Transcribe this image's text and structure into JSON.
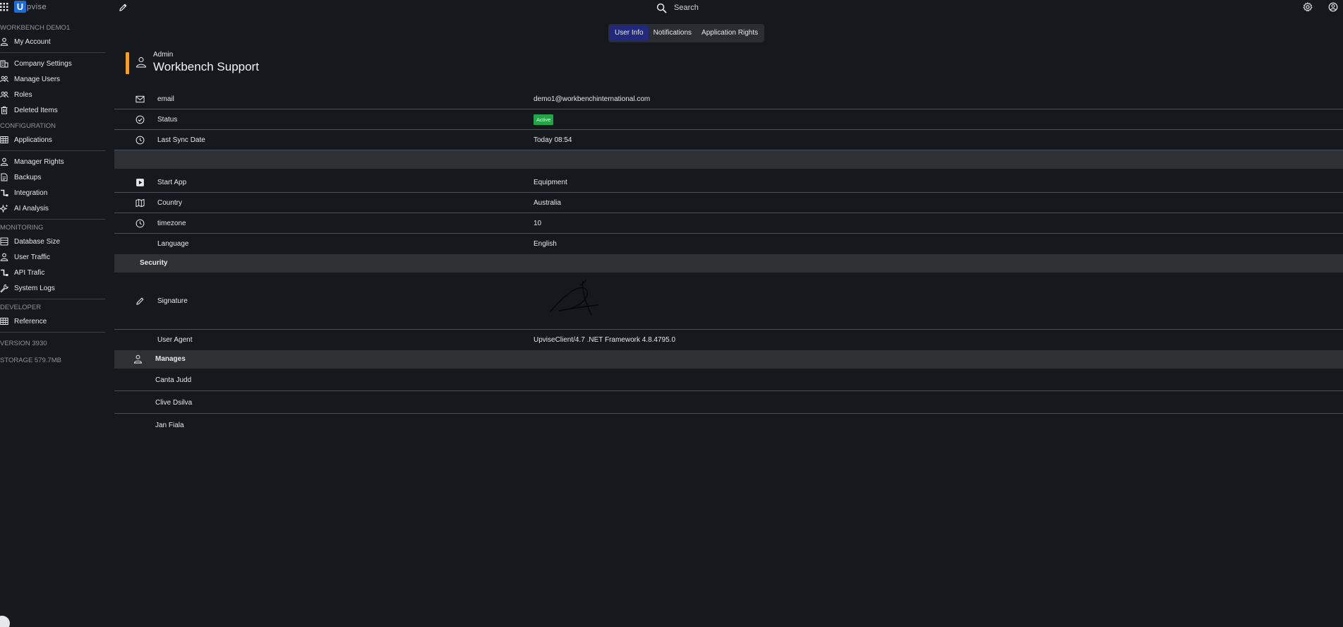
{
  "topbar": {
    "logo_letter": "U",
    "logo_word": "pvise",
    "search_placeholder": "Search"
  },
  "sidebar": {
    "workspace": "WORKBENCH DEMO1",
    "account_items": [
      {
        "label": "My Account",
        "icon": "user-icon"
      },
      {
        "label": "Company Settings",
        "icon": "building-icon"
      },
      {
        "label": "Manage Users",
        "icon": "users-icon"
      },
      {
        "label": "Roles",
        "icon": "users-icon"
      },
      {
        "label": "Deleted Items",
        "icon": "trash-icon"
      }
    ],
    "configuration_label": "CONFIGURATION",
    "configuration_items": [
      {
        "label": "Applications",
        "icon": "grid-icon"
      },
      {
        "label": "Manager Rights",
        "icon": "user-icon"
      },
      {
        "label": "Backups",
        "icon": "document-icon"
      },
      {
        "label": "Integration",
        "icon": "integration-icon"
      },
      {
        "label": "AI Analysis",
        "icon": "sparkle-icon"
      }
    ],
    "monitoring_label": "MONITORING",
    "monitoring_items": [
      {
        "label": "Database Size",
        "icon": "list-icon"
      },
      {
        "label": "User Traffic",
        "icon": "user-icon"
      },
      {
        "label": "API Trafic",
        "icon": "integration-icon"
      },
      {
        "label": "System Logs",
        "icon": "wrench-icon"
      }
    ],
    "developer_label": "DEVELOPER",
    "developer_items": [
      {
        "label": "Reference",
        "icon": "grid-icon"
      }
    ],
    "version": "VERSION 3930",
    "storage": "STORAGE 579.7MB"
  },
  "tabs": [
    "User Info",
    "Notifications",
    "Application Rights"
  ],
  "active_tab": "User Info",
  "header": {
    "role": "Admin",
    "title": "Workbench Support"
  },
  "info": {
    "email_label": "email",
    "email_value": "demo1@workbenchinternational.com",
    "status_label": "Status",
    "status_value": "Active",
    "sync_label": "Last Sync Date",
    "sync_value": "Today 08:54",
    "start_app_label": "Start App",
    "start_app_value": "Equipment",
    "country_label": "Country",
    "country_value": "Australia",
    "timezone_label": "timezone",
    "timezone_value": "10",
    "language_label": "Language",
    "language_value": "English"
  },
  "security": {
    "title": "Security",
    "signature_label": "Signature",
    "user_agent_label": "User Agent",
    "user_agent_value": "UpviseClient/4.7 .NET Framework 4.8.4795.0"
  },
  "manages": {
    "title": "Manages",
    "people": [
      "Canta Judd",
      "Clive Dsilva",
      "Jan Fiala"
    ]
  },
  "colors": {
    "background": "#15181c",
    "accent": "#f0a030",
    "active_tab": "#23297a",
    "status_active": "#22a447",
    "logo": "#1e6bd6"
  }
}
